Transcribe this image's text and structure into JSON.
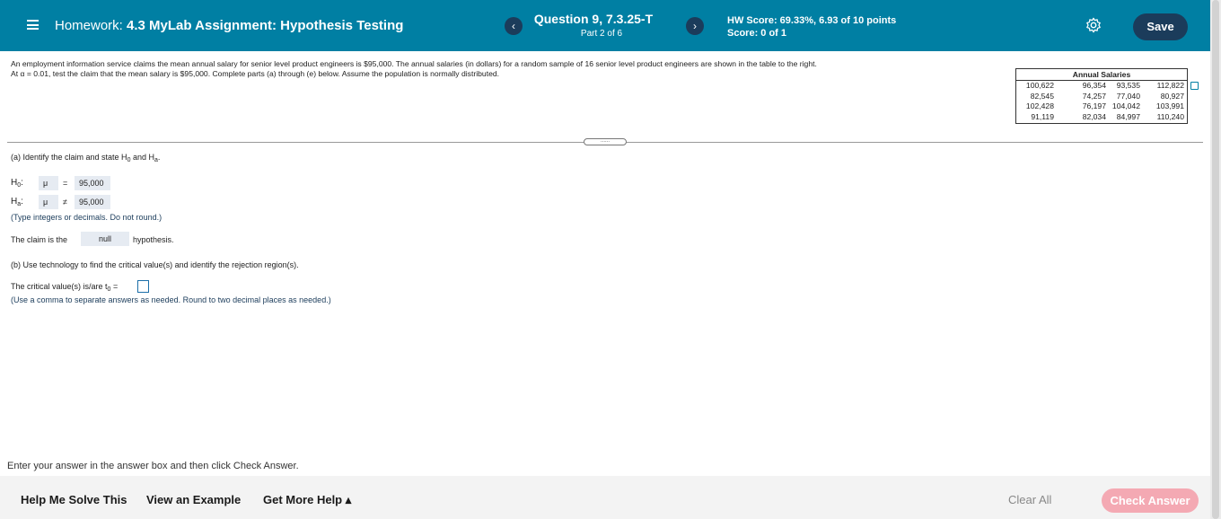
{
  "header": {
    "homework_prefix": "Homework:",
    "homework_name": "4.3 MyLab Assignment: Hypothesis Testing",
    "prev_label": "‹",
    "next_label": "›",
    "question_title": "Question 9, 7.3.25-T",
    "question_part": "Part 2 of 6",
    "hw_score": "HW Score: 69.33%, 6.93 of 10 points",
    "score": "Score: 0 of 1",
    "settings_icon": "gear-icon",
    "save_label": "Save",
    "colors": {
      "bar": "#007fa3",
      "button": "#1b3c5b"
    }
  },
  "problem": {
    "line1": "An employment information service claims the mean annual salary for senior level product engineers is $95,000. The annual salaries (in dollars) for a random sample of 16 senior level product engineers are shown in the table to the right.",
    "line2": "At α = 0.01, test the claim that the mean salary is $95,000. Complete parts (a) through (e) below. Assume the population is normally distributed."
  },
  "table": {
    "header": "Annual Salaries",
    "columns": [
      [
        "100,622",
        "82,545",
        "102,428",
        "91,119"
      ],
      [
        "96,354",
        "74,257",
        "76,197",
        "82,034"
      ],
      [
        "93,535",
        "77,040",
        "104,042",
        "84,997"
      ],
      [
        "112,822",
        "80,927",
        "103,991",
        "110,240"
      ]
    ]
  },
  "divider_handle": "......",
  "part_a": {
    "prompt": "(a) Identify the claim and state H",
    "prompt_sub0": "0",
    "prompt_and": " and H",
    "prompt_suba": "a",
    "prompt_end": ".",
    "h0_label": "H",
    "h0_sub": "0",
    "h0_colon": ":",
    "h0_param": "μ",
    "h0_op": "=",
    "h0_value": "95,000",
    "ha_label": "H",
    "ha_sub": "a",
    "ha_colon": ":",
    "ha_param": "μ",
    "ha_op": "≠",
    "ha_value": "95,000",
    "hint": "(Type integers or decimals. Do not round.)",
    "claim_prefix": "The claim is the",
    "claim_value": "null",
    "claim_suffix": "hypothesis."
  },
  "part_b": {
    "prompt": "(b) Use technology to find the critical value(s) and identify the rejection region(s).",
    "critical_prefix": "The critical value(s) is/are t",
    "critical_sub": "0",
    "critical_eq": " =",
    "critical_value": "",
    "hint": "(Use a comma to separate answers as needed. Round to two decimal places as needed.)"
  },
  "footer": {
    "instruction": "Enter your answer in the answer box and then click Check Answer.",
    "help_solve": "Help Me Solve This",
    "view_example": "View an Example",
    "more_help": "Get More Help ▴",
    "clear_all": "Clear All",
    "check_answer": "Check Answer"
  }
}
